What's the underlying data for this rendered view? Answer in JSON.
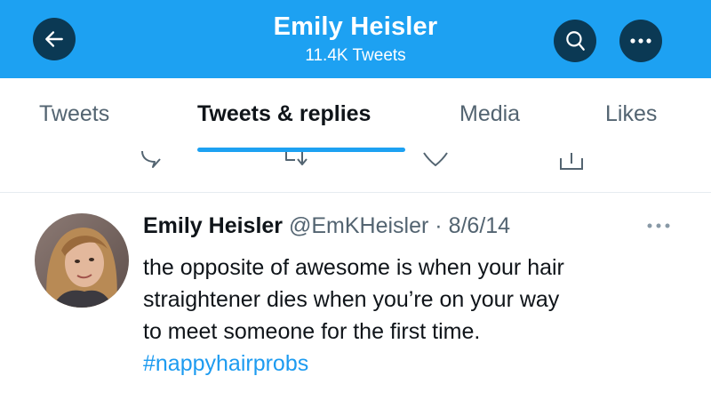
{
  "header": {
    "title": "Emily Heisler",
    "subtitle": "11.4K Tweets",
    "back_icon": "arrow-left-icon",
    "search_icon": "search-icon",
    "more_icon": "more-horizontal-icon",
    "background_color": "#1da1f2",
    "button_color": "#0b3954"
  },
  "tabs": [
    {
      "label": "Tweets",
      "active": false
    },
    {
      "label": "Tweets & replies",
      "active": true
    },
    {
      "label": "Media",
      "active": false
    },
    {
      "label": "Likes",
      "active": false
    }
  ],
  "previous_tweet_actions": [
    "reply-icon",
    "retweet-icon",
    "like-icon",
    "share-icon"
  ],
  "tweet": {
    "name": "Emily Heisler",
    "handle": "@EmKHeisler",
    "separator": "·",
    "date": "8/6/14",
    "lines": [
      "the opposite of awesome is when your hair",
      "straightener dies when you’re on your way",
      "to meet someone for the first time."
    ],
    "hashtag": "#nappyhairprobs",
    "more_icon": "more-horizontal-icon"
  },
  "colors": {
    "accent": "#1da1f2",
    "link": "#1d9bf0",
    "secondary_text": "#536471"
  }
}
